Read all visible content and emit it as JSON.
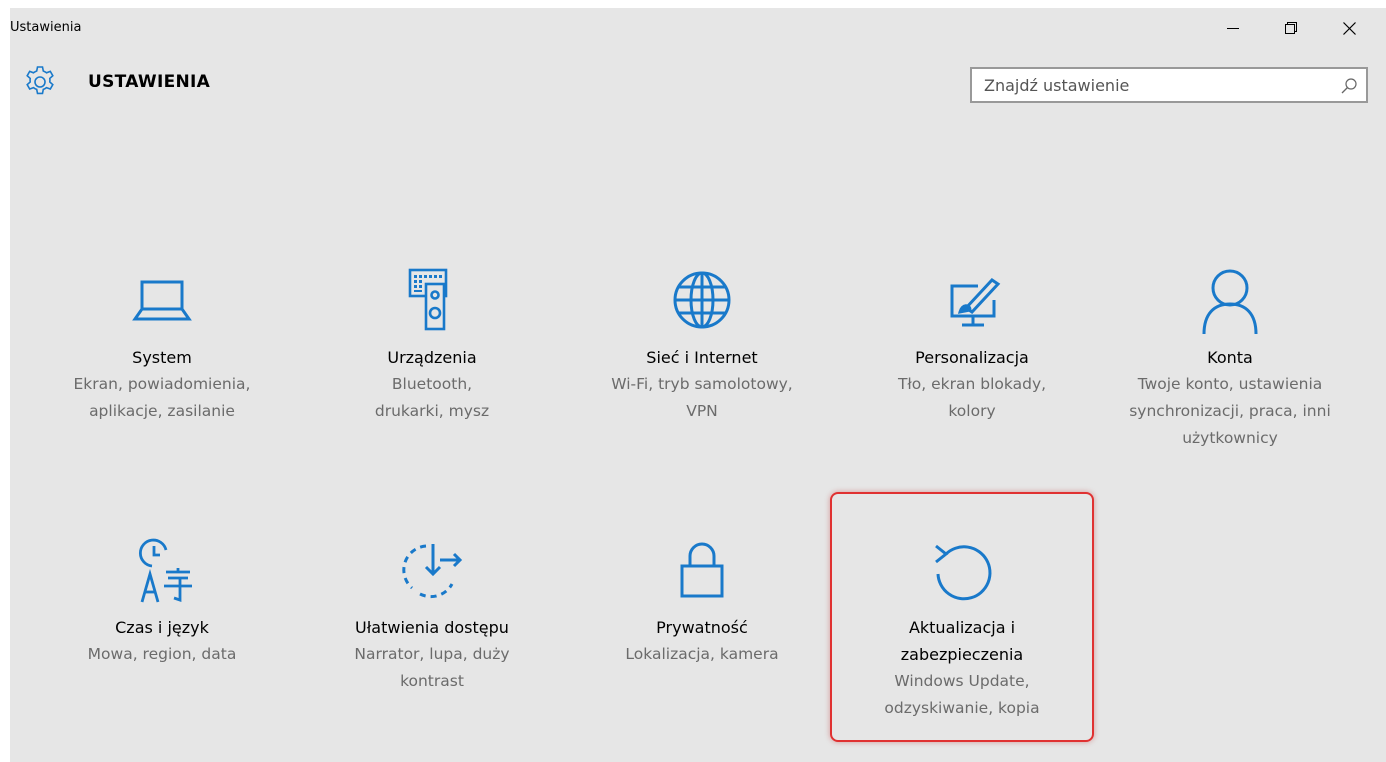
{
  "window": {
    "title": "Ustawienia",
    "controls": {
      "minimize": "–",
      "maximize": "□",
      "close": "✕"
    }
  },
  "header": {
    "title": "USTAWIENIA",
    "icon": "gear-icon"
  },
  "search": {
    "placeholder": "Znajdź ustawienie",
    "value": "",
    "icon": "search-icon"
  },
  "accent_color": "#1979ca",
  "tiles": [
    {
      "id": "system",
      "icon": "laptop-icon",
      "name": "System",
      "desc": "Ekran, powiadomienia, aplikacje, zasilanie"
    },
    {
      "id": "devices",
      "icon": "devices-icon",
      "name": "Urządzenia",
      "desc": "Bluetooth, drukarki, mysz"
    },
    {
      "id": "network",
      "icon": "globe-icon",
      "name": "Sieć i Internet",
      "desc": "Wi-Fi, tryb samolotowy, VPN"
    },
    {
      "id": "personalization",
      "icon": "personalization-icon",
      "name": "Personalizacja",
      "desc": "Tło, ekran blokady, kolory"
    },
    {
      "id": "accounts",
      "icon": "person-icon",
      "name": "Konta",
      "desc": "Twoje konto, ustawienia synchronizacji, praca, inni użytkownicy"
    },
    {
      "id": "time-language",
      "icon": "time-language-icon",
      "name": "Czas i język",
      "desc": "Mowa, region, data"
    },
    {
      "id": "ease-of-access",
      "icon": "ease-of-access-icon",
      "name": "Ułatwienia dostępu",
      "desc": "Narrator, lupa, duży kontrast"
    },
    {
      "id": "privacy",
      "icon": "lock-icon",
      "name": "Prywatność",
      "desc": "Lokalizacja, kamera"
    },
    {
      "id": "update-security",
      "icon": "update-icon",
      "name": "Aktualizacja i zabezpieczenia",
      "desc": "Windows Update, odzyskiwanie, kopia",
      "highlighted": true
    }
  ],
  "highlight_color": "#e03131"
}
